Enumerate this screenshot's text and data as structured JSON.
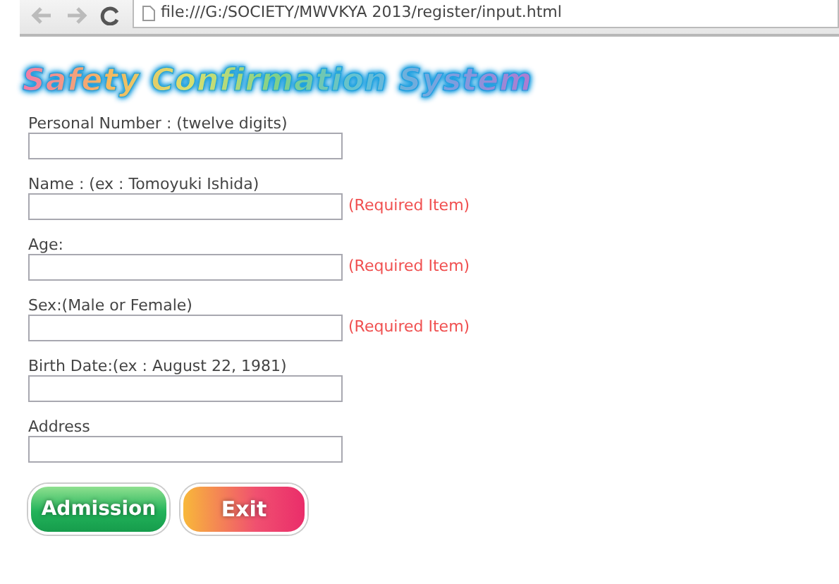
{
  "browser": {
    "url": "file:///G:/SOCIETY/MWVKYA 2013/register/input.html"
  },
  "title": "Safety Confirmation System",
  "fields": [
    {
      "label": "Personal Number : (twelve digits)"
    },
    {
      "label": "Name : (ex : Tomoyuki Ishida)",
      "note": "(Required Item)"
    },
    {
      "label": "Age:",
      "note": "(Required Item)"
    },
    {
      "label": "Sex:(Male or Female)",
      "note": "(Required Item)"
    },
    {
      "label": "Birth Date:(ex : August 22, 1981)"
    },
    {
      "label": "Address"
    }
  ],
  "buttons": [
    {
      "label": "Admission",
      "kind": "submit"
    },
    {
      "label": "Exit",
      "kind": "exit"
    }
  ]
}
